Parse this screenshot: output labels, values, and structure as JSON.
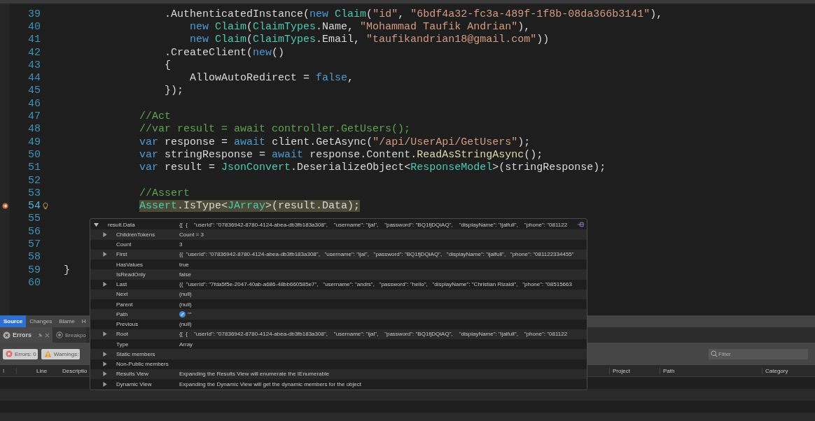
{
  "editor": {
    "lines": [
      {
        "number": "39",
        "selected": false,
        "tokens": [
          {
            "kind": "plain",
            "text": "                .AuthenticatedInstance("
          },
          {
            "kind": "keyword",
            "text": "new "
          },
          {
            "kind": "type",
            "text": "Claim"
          },
          {
            "kind": "plain",
            "text": "("
          },
          {
            "kind": "string",
            "text": "\"id\""
          },
          {
            "kind": "plain",
            "text": ", "
          },
          {
            "kind": "string",
            "text": "\"6bdf4a32-fc3a-489f-1f8b-08da366b3141\""
          },
          {
            "kind": "plain",
            "text": "),"
          }
        ]
      },
      {
        "number": "40",
        "selected": false,
        "tokens": [
          {
            "kind": "keyword",
            "text": "                    new "
          },
          {
            "kind": "type",
            "text": "Claim"
          },
          {
            "kind": "plain",
            "text": "("
          },
          {
            "kind": "type",
            "text": "ClaimTypes"
          },
          {
            "kind": "plain",
            "text": ".Name, "
          },
          {
            "kind": "string",
            "text": "\"Mohammad Taufik Andrian\""
          },
          {
            "kind": "plain",
            "text": "),"
          }
        ]
      },
      {
        "number": "41",
        "selected": false,
        "tokens": [
          {
            "kind": "keyword",
            "text": "                    new "
          },
          {
            "kind": "type",
            "text": "Claim"
          },
          {
            "kind": "plain",
            "text": "("
          },
          {
            "kind": "type",
            "text": "ClaimTypes"
          },
          {
            "kind": "plain",
            "text": ".Email, "
          },
          {
            "kind": "string",
            "text": "\"taufikandrian18@gmail.com\""
          },
          {
            "kind": "plain",
            "text": "))"
          }
        ]
      },
      {
        "number": "42",
        "selected": false,
        "tokens": [
          {
            "kind": "plain",
            "text": "                .CreateClient("
          },
          {
            "kind": "keyword",
            "text": "new"
          },
          {
            "kind": "plain",
            "text": "()"
          }
        ]
      },
      {
        "number": "43",
        "selected": false,
        "tokens": [
          {
            "kind": "plain",
            "text": "                {"
          }
        ]
      },
      {
        "number": "44",
        "selected": false,
        "tokens": [
          {
            "kind": "plain",
            "text": "                    AllowAutoRedirect = "
          },
          {
            "kind": "keyword",
            "text": "false"
          },
          {
            "kind": "plain",
            "text": ","
          }
        ]
      },
      {
        "number": "45",
        "selected": false,
        "tokens": [
          {
            "kind": "plain",
            "text": "                });"
          }
        ]
      },
      {
        "number": "46",
        "selected": false
      },
      {
        "number": "47",
        "selected": false,
        "tokens": [
          {
            "kind": "comment",
            "text": "            //Act"
          }
        ]
      },
      {
        "number": "48",
        "selected": false,
        "tokens": [
          {
            "kind": "comment",
            "text": "            //var result = await controller.GetUsers();"
          }
        ]
      },
      {
        "number": "49",
        "selected": false,
        "tokens": [
          {
            "kind": "keyword",
            "text": "            var"
          },
          {
            "kind": "plain",
            "text": " response = "
          },
          {
            "kind": "keyword",
            "text": "await"
          },
          {
            "kind": "plain",
            "text": " client.GetAsync("
          },
          {
            "kind": "string",
            "text": "\"/api/UserApi/GetUsers\""
          },
          {
            "kind": "plain",
            "text": ");"
          }
        ]
      },
      {
        "number": "50",
        "selected": false,
        "tokens": [
          {
            "kind": "keyword",
            "text": "            var"
          },
          {
            "kind": "plain",
            "text": " stringResponse = "
          },
          {
            "kind": "keyword",
            "text": "await"
          },
          {
            "kind": "plain",
            "text": " response.Content."
          },
          {
            "kind": "method",
            "text": "ReadAsStringAsync"
          },
          {
            "kind": "plain",
            "text": "();"
          }
        ]
      },
      {
        "number": "51",
        "selected": false,
        "tokens": [
          {
            "kind": "keyword",
            "text": "            var"
          },
          {
            "kind": "plain",
            "text": " result = "
          },
          {
            "kind": "type",
            "text": "JsonConvert"
          },
          {
            "kind": "plain",
            "text": ".DeserializeObject<"
          },
          {
            "kind": "type",
            "text": "ResponseModel"
          },
          {
            "kind": "plain",
            "text": ">(stringResponse);"
          }
        ]
      },
      {
        "number": "52",
        "selected": false
      },
      {
        "number": "53",
        "selected": false,
        "tokens": [
          {
            "kind": "comment",
            "text": "            //Assert"
          }
        ]
      },
      {
        "number": "54",
        "selected": true,
        "tokens": [
          {
            "kind": "type",
            "text": "            Assert"
          },
          {
            "kind": "plain",
            "text": ".IsType<"
          },
          {
            "kind": "type",
            "text": "JArray"
          },
          {
            "kind": "plain",
            "text": ">(result.Data);"
          }
        ]
      },
      {
        "number": "55",
        "selected": false
      },
      {
        "number": "56",
        "selected": false
      },
      {
        "number": "57",
        "selected": false
      },
      {
        "number": "58",
        "selected": false
      },
      {
        "number": "59",
        "selected": false,
        "tokens": [
          {
            "kind": "plain",
            "text": "}"
          }
        ]
      },
      {
        "number": "60",
        "selected": false
      }
    ]
  },
  "datatip": {
    "name": "result.Data",
    "expanded": true,
    "value": "{[  {    \"userId\": \"07836942-8780-4124-abea-db3fb183a308\",    \"username\": \"ijal\",    \"password\": \"BQ1fjDQiAQ\",    \"displayName\": \"ijalfull\",    \"phone\": \"081122",
    "children": [
      {
        "name": "ChildrenTokens",
        "value": "Count = 3",
        "expandable": true,
        "icon": false
      },
      {
        "name": "Count",
        "value": "3",
        "expandable": false,
        "icon": false
      },
      {
        "name": "First",
        "value": "{{  \"userId\": \"07836942-8780-4124-abea-db3fb183a308\",   \"username\": \"ijal\",   \"password\": \"BQ1fjDQiAQ\",   \"displayName\": \"ijalfull\",   \"phone\": \"081122334455\"",
        "expandable": true,
        "icon": false
      },
      {
        "name": "HasValues",
        "value": "true",
        "expandable": false,
        "icon": false
      },
      {
        "name": "IsReadOnly",
        "value": "false",
        "expandable": false,
        "icon": false
      },
      {
        "name": "Last",
        "value": "{{  \"userId\": \"7fda5f5e-2047-40ab-a686-48bb660585e7\",   \"username\": \"andrs\",   \"password\": \"hello\",   \"displayName\": \"Christian Rizaldi\",   \"phone\": \"08515663",
        "expandable": true,
        "icon": false
      },
      {
        "name": "Next",
        "value": "(null)",
        "expandable": false,
        "icon": false
      },
      {
        "name": "Parent",
        "value": "(null)",
        "expandable": false,
        "icon": false
      },
      {
        "name": "Path",
        "value": "\"\"",
        "expandable": false,
        "icon": true
      },
      {
        "name": "Previous",
        "value": "(null)",
        "expandable": false,
        "icon": false
      },
      {
        "name": "Root",
        "value": "{[  {    \"userId\": \"07836942-8780-4124-abea-db3fb183a308\",    \"username\": \"ijal\",    \"password\": \"BQ1fjDQiAQ\",    \"displayName\": \"ijalfull\",    \"phone\": \"081122",
        "expandable": true,
        "icon": false
      },
      {
        "name": "Type",
        "value": "Array",
        "expandable": false,
        "icon": false
      },
      {
        "name": "Static members",
        "expandable": true,
        "icon": false
      },
      {
        "name": "Non-Public members",
        "expandable": true,
        "icon": false
      },
      {
        "name": "Results View",
        "value": "Expanding the Results View will enumerate the IEnumerable",
        "expandable": true,
        "icon": false
      },
      {
        "name": "Dynamic View",
        "value": "Expanding the Dynamic View will get the dynamic members for the object",
        "expandable": true,
        "icon": false
      }
    ]
  },
  "panel": {
    "tabs": [
      {
        "label": "Source",
        "selected": true
      },
      {
        "label": "Changes",
        "selected": false
      },
      {
        "label": "Blame",
        "selected": false
      },
      {
        "label": "H",
        "selected": false
      }
    ],
    "pad_tabs": [
      {
        "label": "Errors",
        "kind": "errors",
        "selected": true
      },
      {
        "label": "Breakpo",
        "kind": "breakpoints",
        "selected": false
      }
    ],
    "filters": [
      {
        "label": "Errors: 0",
        "kind": "error"
      },
      {
        "label": "Warnings:",
        "kind": "warning"
      }
    ],
    "search": {
      "placeholder": "Filter"
    },
    "columns": [
      "!",
      "Line",
      "Descriptio",
      "Project",
      "Path",
      "Category"
    ]
  }
}
